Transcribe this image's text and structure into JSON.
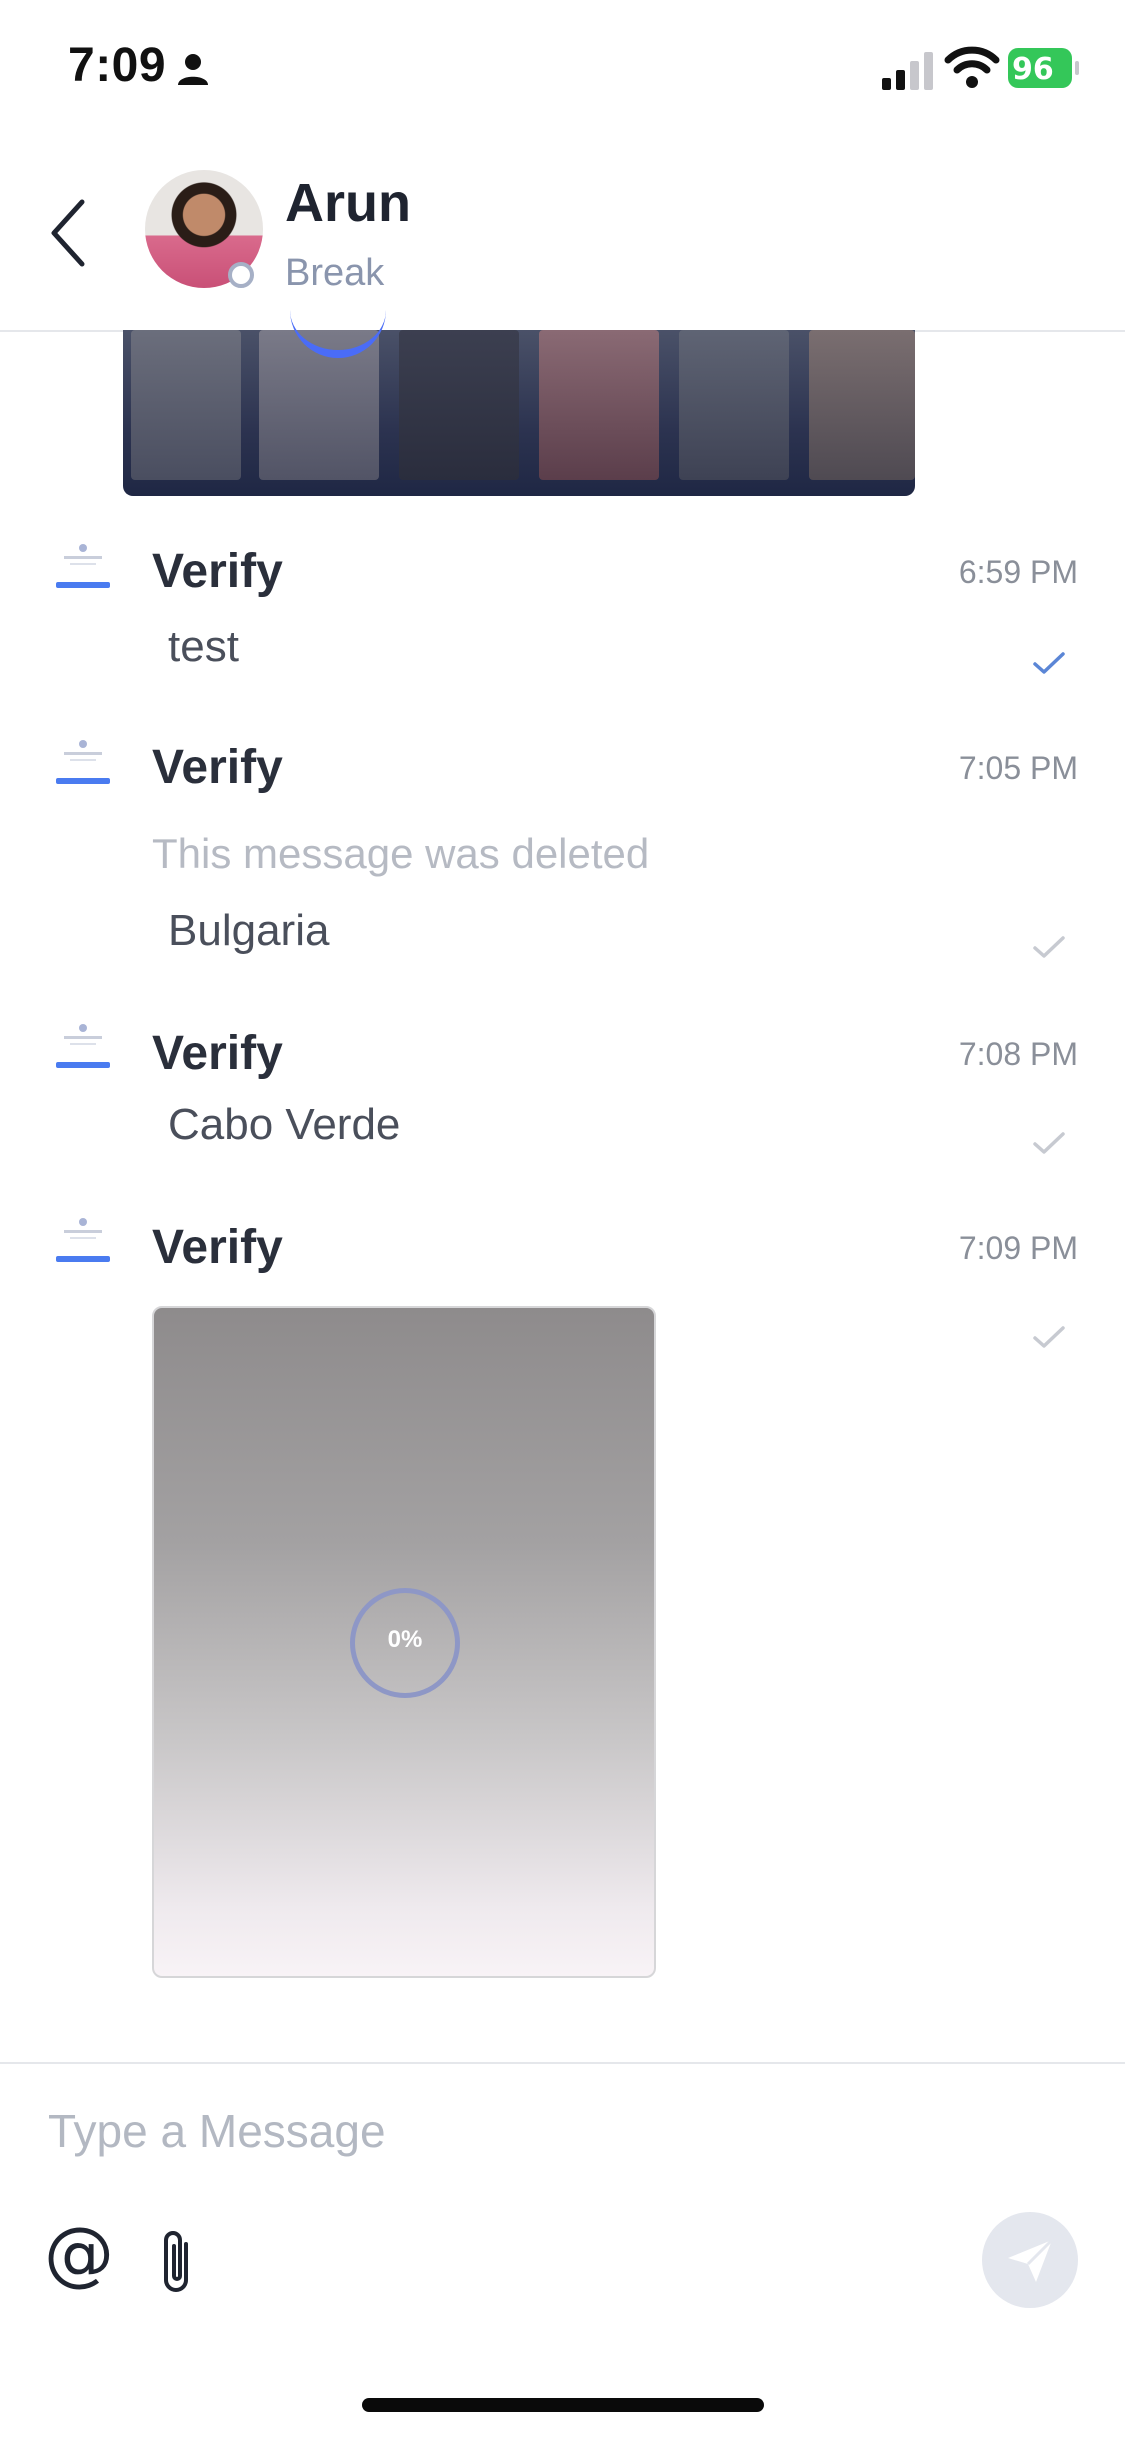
{
  "status_bar": {
    "time": "7:09",
    "battery": "96"
  },
  "header": {
    "contact_name": "Arun",
    "contact_status": "Break"
  },
  "messages": [
    {
      "sender": "Verify",
      "time": "6:59 PM",
      "text": "test",
      "read": true
    },
    {
      "sender": "Verify",
      "time": "7:05 PM",
      "deleted_text": "This message was deleted",
      "text": "Bulgaria",
      "read": false
    },
    {
      "sender": "Verify",
      "time": "7:08 PM",
      "text": "Cabo Verde",
      "read": false
    },
    {
      "sender": "Verify",
      "time": "7:09 PM",
      "upload_progress": "0%",
      "read": false
    }
  ],
  "composer": {
    "placeholder": "Type a Message",
    "mention_symbol": "@"
  },
  "colors": {
    "accent": "#4a6cf7",
    "check_read": "#5b86d6",
    "check_sent": "#c7cad1",
    "battery": "#34c759"
  }
}
